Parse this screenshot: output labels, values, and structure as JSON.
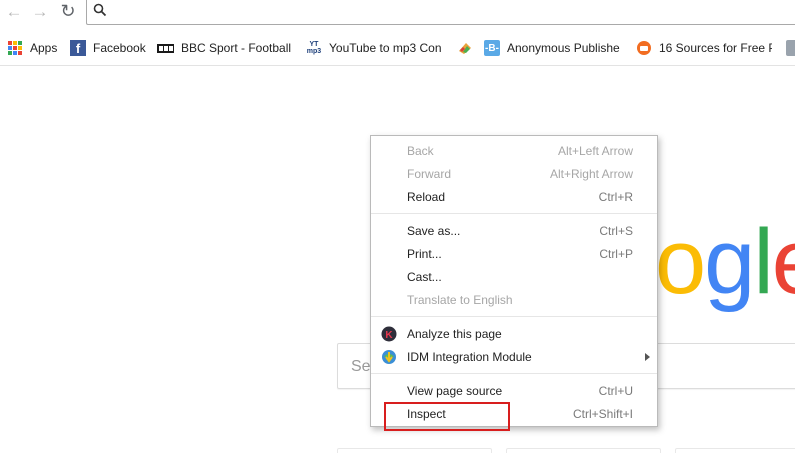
{
  "colors": {
    "accent_highlight": "#d81e1e",
    "google_blue": "#4285f4",
    "google_red": "#ea4335",
    "google_yellow": "#fbbc05",
    "google_green": "#34a853"
  },
  "toolbar": {
    "back_icon": "back-arrow-icon",
    "forward_icon": "forward-arrow-icon",
    "reload_icon": "reload-icon",
    "address_value": ""
  },
  "bookmarks": [
    {
      "label": "Apps",
      "icon": "apps-grid-icon"
    },
    {
      "label": "Facebook",
      "icon": "facebook-icon"
    },
    {
      "label": "BBC Sport - Football",
      "icon": "bbc-icon"
    },
    {
      "label": "YouTube to mp3 Con",
      "icon": "yt-mp3-icon"
    },
    {
      "label": "",
      "icon": "parrot-icon"
    },
    {
      "label": "Anonymous Publishe",
      "icon": "blogger-icon"
    },
    {
      "label": "16 Sources for Free P",
      "icon": "reader-icon"
    },
    {
      "label": "",
      "icon": "avatar-icon"
    }
  ],
  "page": {
    "logo_letters": [
      "o",
      "g",
      "l",
      "e"
    ],
    "search_placeholder": "Se"
  },
  "context_menu": {
    "groups": [
      [
        {
          "label": "Back",
          "shortcut": "Alt+Left Arrow",
          "disabled": true
        },
        {
          "label": "Forward",
          "shortcut": "Alt+Right Arrow",
          "disabled": true
        },
        {
          "label": "Reload",
          "shortcut": "Ctrl+R",
          "disabled": false
        }
      ],
      [
        {
          "label": "Save as...",
          "shortcut": "Ctrl+S",
          "disabled": false
        },
        {
          "label": "Print...",
          "shortcut": "Ctrl+P",
          "disabled": false
        },
        {
          "label": "Cast...",
          "shortcut": "",
          "disabled": false
        },
        {
          "label": "Translate to English",
          "shortcut": "",
          "disabled": true
        }
      ],
      [
        {
          "label": "Analyze this page",
          "shortcut": "",
          "disabled": false,
          "icon": "kaspersky-icon"
        },
        {
          "label": "IDM Integration Module",
          "shortcut": "",
          "disabled": false,
          "icon": "idm-icon",
          "submenu": true
        }
      ],
      [
        {
          "label": "View page source",
          "shortcut": "Ctrl+U",
          "disabled": false
        },
        {
          "label": "Inspect",
          "shortcut": "Ctrl+Shift+I",
          "disabled": false,
          "highlighted": true
        }
      ]
    ]
  }
}
